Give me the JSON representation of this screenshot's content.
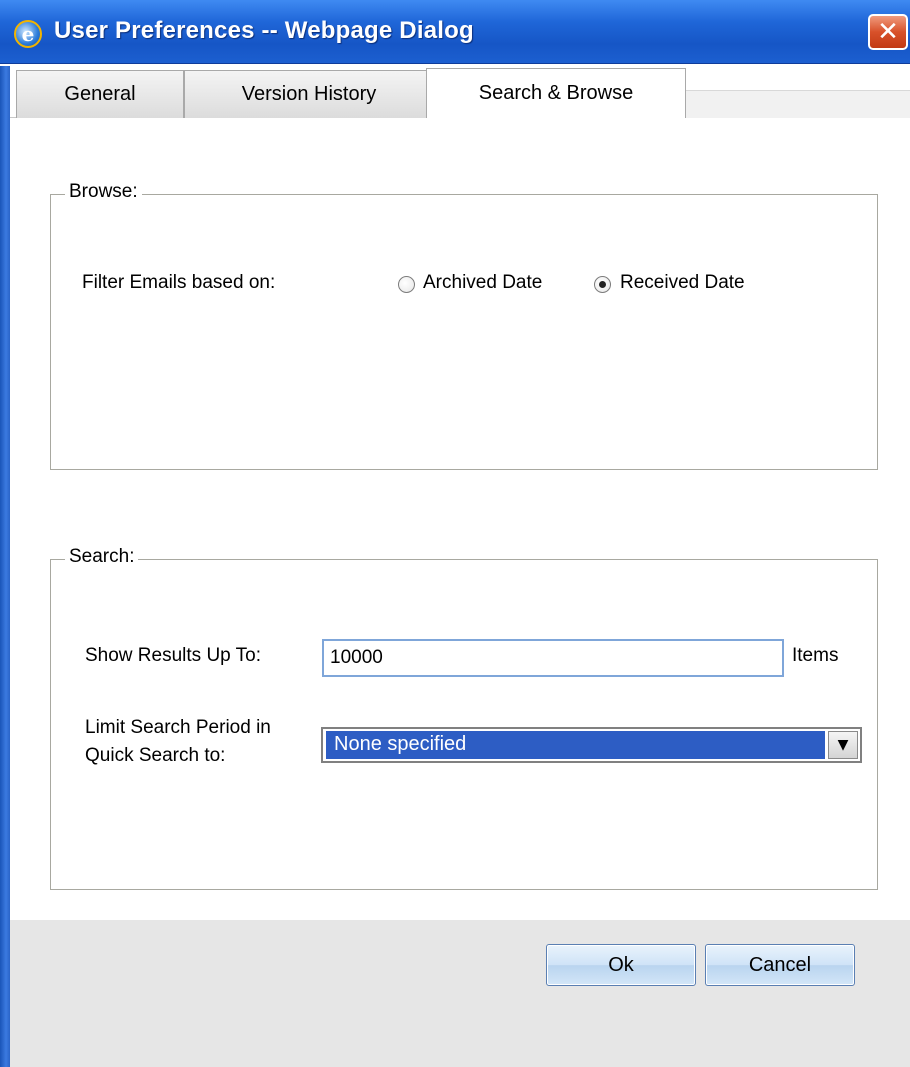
{
  "window": {
    "title": "User Preferences -- Webpage Dialog",
    "icon": "ie-icon",
    "close_glyph": "✕",
    "accent": "#1f66d8"
  },
  "tabs": [
    {
      "label": "General",
      "active": false
    },
    {
      "label": "Version History",
      "active": false
    },
    {
      "label": "Search & Browse",
      "active": true
    }
  ],
  "browse": {
    "legend": "Browse:",
    "filter_label": "Filter Emails based on:",
    "options": [
      {
        "label": "Archived Date",
        "checked": false
      },
      {
        "label": "Received Date",
        "checked": true
      }
    ]
  },
  "search": {
    "legend": "Search:",
    "results_label": "Show Results Up To:",
    "results_value": "10000",
    "results_unit": "Items",
    "period_label_line1": "Limit Search Period in",
    "period_label_line2": "Quick Search to:",
    "period_selected": "None specified",
    "period_selected_color": "#2d5dc4"
  },
  "buttons": {
    "ok_label": "Ok",
    "cancel_label": "Cancel"
  }
}
